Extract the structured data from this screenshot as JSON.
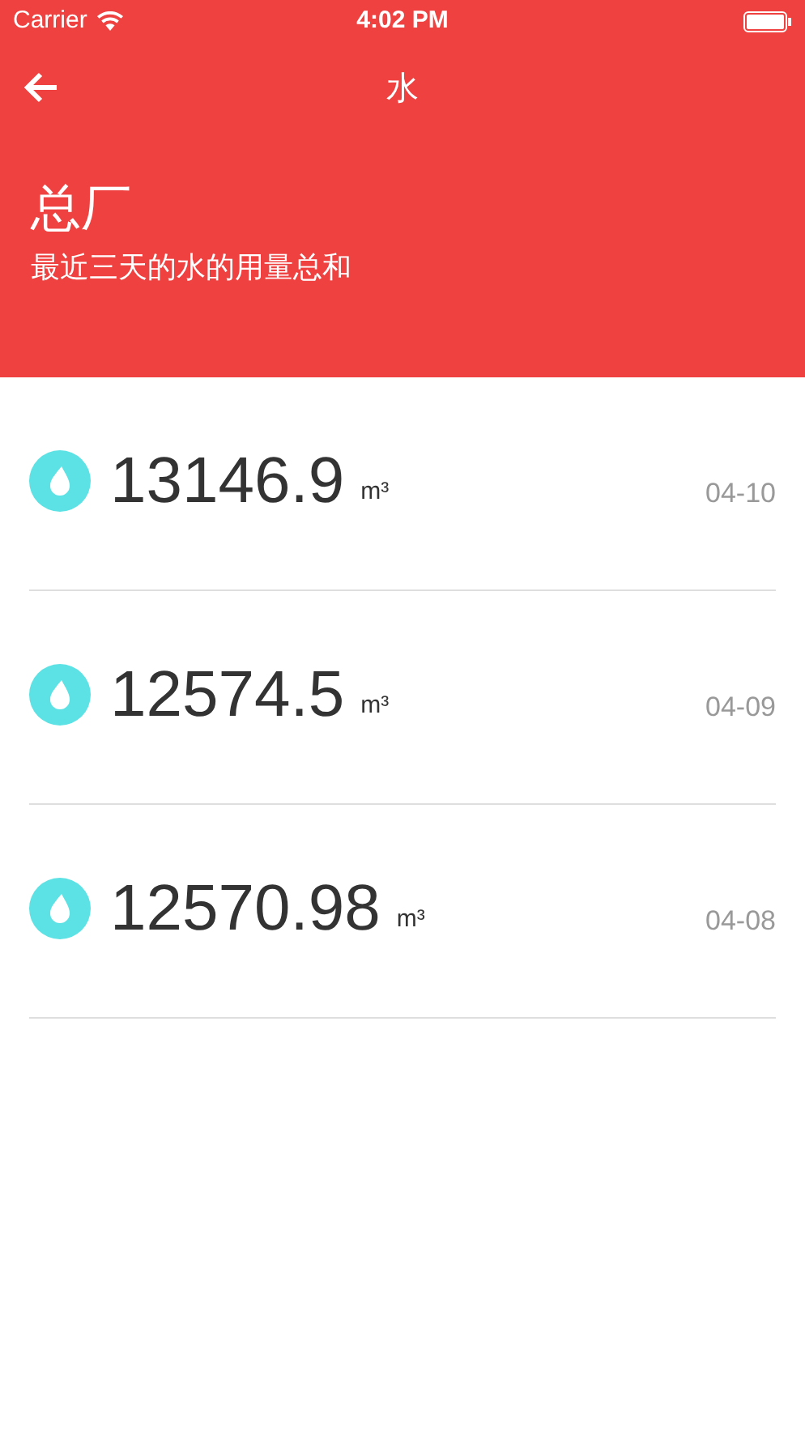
{
  "status_bar": {
    "carrier": "Carrier",
    "time": "4:02 PM"
  },
  "nav": {
    "title": "水"
  },
  "header": {
    "title": "总厂",
    "subtitle": "最近三天的水的用量总和"
  },
  "readings": [
    {
      "value": "13146.9",
      "unit": "m³",
      "date": "04-10"
    },
    {
      "value": "12574.5",
      "unit": "m³",
      "date": "04-09"
    },
    {
      "value": "12570.98",
      "unit": "m³",
      "date": "04-08"
    }
  ]
}
